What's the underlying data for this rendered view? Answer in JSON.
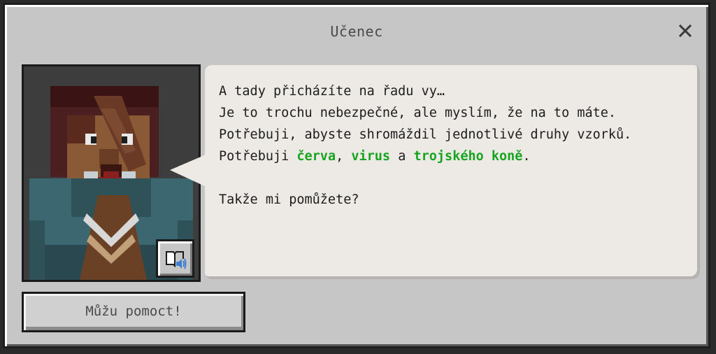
{
  "dialog": {
    "title": "Učenec",
    "close_icon": "close-icon"
  },
  "npc": {
    "portrait_icon": "npc-scholar-portrait",
    "tts_icon": "book-speaker-icon"
  },
  "speech": {
    "line1": "A tady přicházíte na řadu vy…",
    "line2": "Je to trochu nebezpečné, ale myslím, že na to máte.",
    "line3": "Potřebuji, abyste shromáždil jednotlivé druhy vzorků.",
    "line4": {
      "prefix": "Potřebuji ",
      "item1": "červa",
      "sep1": ", ",
      "item2": "virus",
      "sep2": " a ",
      "item3": "trojského koně",
      "suffix": "."
    },
    "line5": "",
    "line6": "Takže mi pomůžete?",
    "highlight_color": "#17a51f"
  },
  "actions": {
    "help_label": "Můžu pomoct!"
  }
}
